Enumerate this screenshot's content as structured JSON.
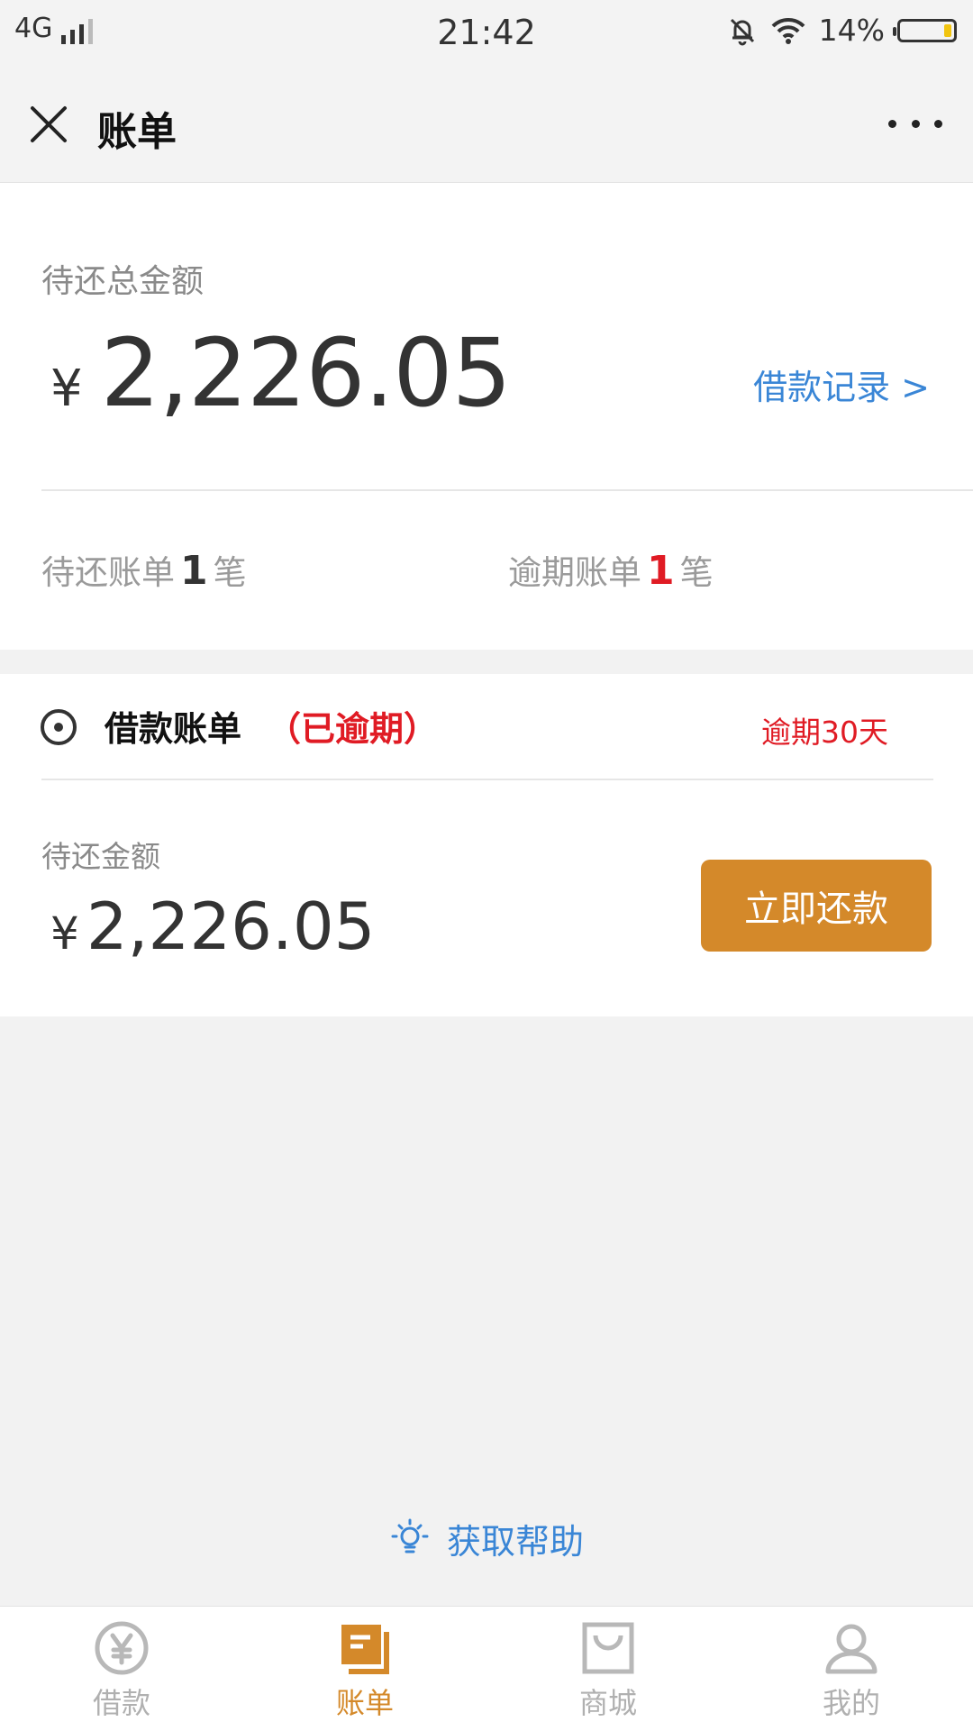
{
  "status_bar": {
    "network": "4G",
    "time": "21:42",
    "battery": "14%",
    "battery_level": 0.14
  },
  "header": {
    "title": "账单"
  },
  "summary": {
    "label": "待还总金额",
    "currency": "¥",
    "amount": "2,226.05",
    "loan_records_link": "借款记录 >",
    "pending": {
      "prefix": "待还账单",
      "count": "1",
      "suffix": "笔"
    },
    "overdue": {
      "prefix": "逾期账单",
      "count": "1",
      "suffix": "笔"
    }
  },
  "bill": {
    "title": "借款账单",
    "status": "（已逾期）",
    "overdue_days": "逾期30天",
    "amount_label": "待还金额",
    "currency": "¥",
    "amount": "2,226.05",
    "repay_button": "立即还款"
  },
  "help": {
    "label": "获取帮助"
  },
  "bottom_nav": {
    "items": [
      {
        "label": "借款",
        "icon": "yen-coin-icon"
      },
      {
        "label": "账单",
        "icon": "bill-icon",
        "active": true
      },
      {
        "label": "商城",
        "icon": "shopping-bag-icon"
      },
      {
        "label": "我的",
        "icon": "user-icon"
      }
    ]
  },
  "colors": {
    "accent": "#d4892a",
    "link": "#3a86d6",
    "danger": "#e01b24"
  }
}
